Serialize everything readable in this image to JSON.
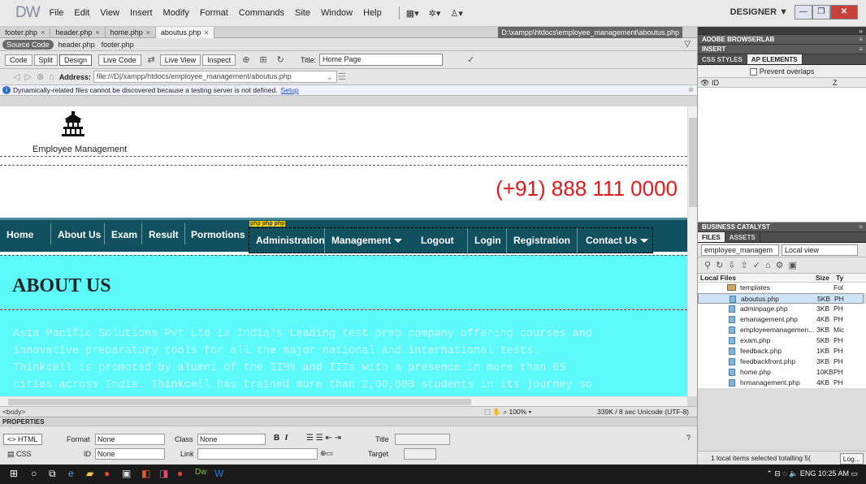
{
  "app": {
    "logo": "DW",
    "designer": "DESIGNER ▼"
  },
  "menu": [
    "File",
    "Edit",
    "View",
    "Insert",
    "Modify",
    "Format",
    "Commands",
    "Site",
    "Window",
    "Help"
  ],
  "tabs": [
    {
      "label": "footer.php",
      "active": false
    },
    {
      "label": "header.php",
      "active": false
    },
    {
      "label": "home.php",
      "active": false
    },
    {
      "label": "aboutus.php",
      "active": true
    }
  ],
  "doc_path": "D:\\xampp\\htdocs\\employee_management\\aboutus.php",
  "related": {
    "source_code": "Source Code",
    "files": [
      "header.php",
      "footer.php"
    ]
  },
  "toolbar": {
    "code": "Code",
    "split": "Split",
    "design": "Design",
    "live_code": "Live Code",
    "live_view": "Live View",
    "inspect": "Inspect",
    "title_label": "Title:",
    "title_value": "Home Page"
  },
  "address": {
    "label": "Address:",
    "value": "file:///D|/xampp/htdocs/employee_management/aboutus.php"
  },
  "info": {
    "text": "Dynamically-related files cannot be discovered because a testing server is not defined.",
    "link": "Setup"
  },
  "page": {
    "brand": "Employee Management",
    "phone": "(+91) 888 111 0000",
    "nav": [
      "Home",
      "About Us",
      "Exam",
      "Result",
      "Pormotions"
    ],
    "php_badge": "php php php",
    "subnav": [
      "Administration",
      "Management",
      "Logout",
      "Login",
      "Registration",
      "Contact Us"
    ],
    "about_title": "ABOUT US",
    "paragraph": [
      "Asia Pacific Solutions Pvt Ltd is India's Leading test prep company offering courses and",
      "innovative preparatory tools for all the major national and international tests.",
      "Thinkcell is promoted by alumni of the IIMs and IITs with a presence in more than 65",
      "cities across India. Thinkcell has trained more than 2,00,000 students in its journey so"
    ]
  },
  "status": {
    "tag": "<body>",
    "zoom": "100%",
    "size": "339K / 8 sec  Unicode (UTF-8)"
  },
  "properties": {
    "header": "PROPERTIES",
    "html": "HTML",
    "css": "CSS",
    "format_label": "Format",
    "format_value": "None",
    "class_label": "Class",
    "class_value": "None",
    "id_label": "ID",
    "id_value": "None",
    "link_label": "Link",
    "title_label": "Title",
    "target_label": "Target"
  },
  "right": {
    "panels": [
      "ADOBE BROWSERLAB",
      "INSERT"
    ],
    "css_tabs": [
      "CSS STYLES",
      "AP ELEMENTS"
    ],
    "prevent_overlaps": "Prevent overlaps",
    "ap_id": "ID",
    "ap_z": "Z",
    "business": "BUSINESS CATALYST",
    "file_tabs": [
      "FILES",
      "ASSETS"
    ],
    "site": "employee_managem",
    "view": "Local view",
    "files_header": {
      "name": "Local Files",
      "size": "Size",
      "type": "Ty"
    },
    "files": [
      {
        "name": "templates",
        "size": "",
        "type": "Fol",
        "folder": true,
        "selected": false
      },
      {
        "name": "aboutus.php",
        "size": "5KB",
        "type": "PH",
        "folder": false,
        "selected": true
      },
      {
        "name": "adminpage.php",
        "size": "3KB",
        "type": "PH",
        "folder": false,
        "selected": false
      },
      {
        "name": "emanagement.php",
        "size": "4KB",
        "type": "PH",
        "folder": false,
        "selected": false
      },
      {
        "name": "employeemanagemen...",
        "size": "3KB",
        "type": "Mic",
        "folder": false,
        "selected": false
      },
      {
        "name": "exam.php",
        "size": "5KB",
        "type": "PH",
        "folder": false,
        "selected": false
      },
      {
        "name": "feedback.php",
        "size": "1KB",
        "type": "PH",
        "folder": false,
        "selected": false
      },
      {
        "name": "feedbackfront.php",
        "size": "3KB",
        "type": "PH",
        "folder": false,
        "selected": false
      },
      {
        "name": "home.php",
        "size": "10KB",
        "type": "PH",
        "folder": false,
        "selected": false
      },
      {
        "name": "hrmanagement.php",
        "size": "4KB",
        "type": "PH",
        "folder": false,
        "selected": false
      }
    ],
    "files_status": "1 local items selected totalling 5(",
    "log": "Log..."
  },
  "taskbar": {
    "lang": "ENG",
    "time": "10:25 AM"
  }
}
